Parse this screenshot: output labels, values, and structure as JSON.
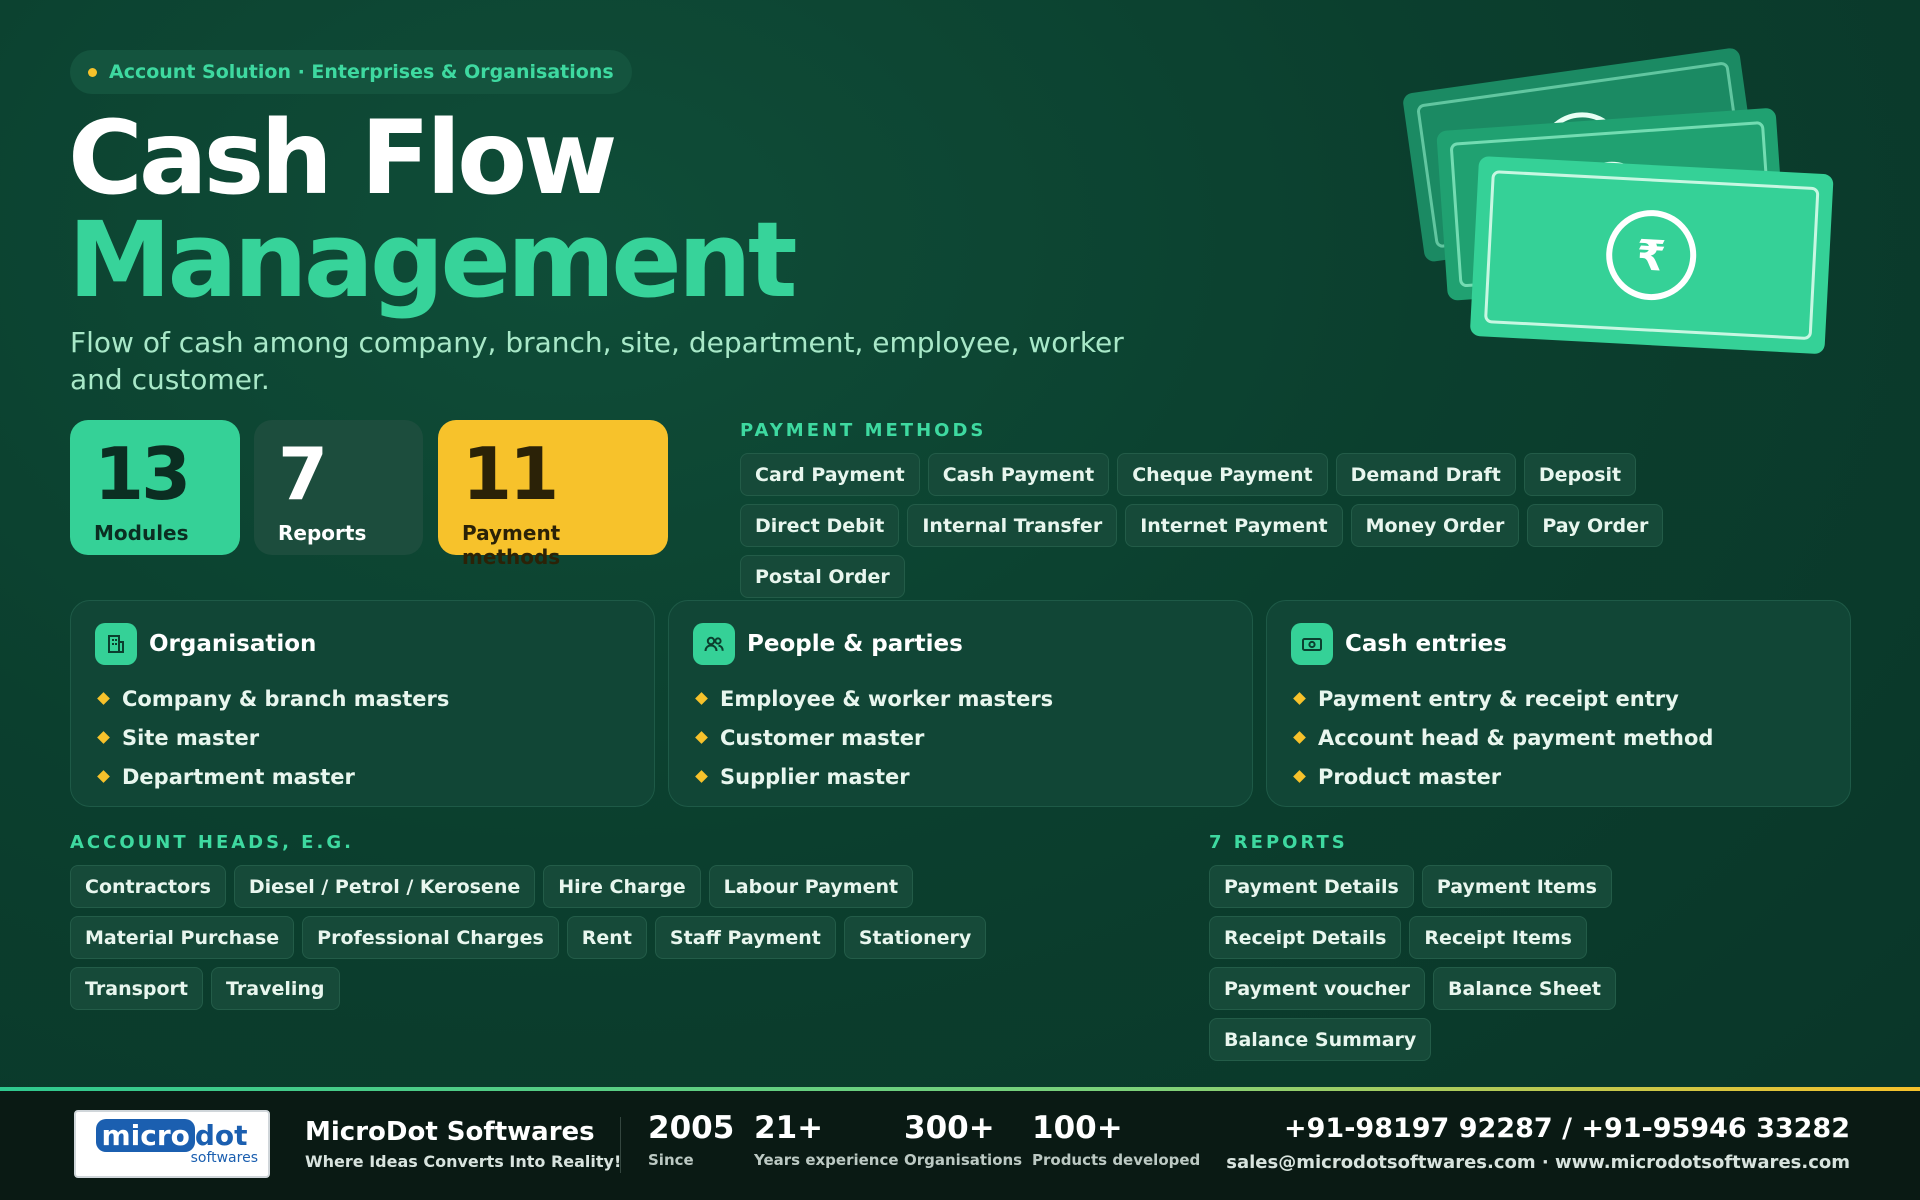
{
  "badge": "Account Solution · Enterprises & Organisations",
  "title": {
    "line1": "Cash Flow",
    "line2": "Management"
  },
  "subtitle": "Flow of cash among company, branch, site, department, employee, worker and customer.",
  "stats": [
    {
      "value": "13",
      "label": "Modules"
    },
    {
      "value": "7",
      "label": "Reports"
    },
    {
      "value": "11",
      "label": "Payment methods"
    }
  ],
  "payment_methods": {
    "label": "PAYMENT METHODS",
    "items": [
      "Card Payment",
      "Cash Payment",
      "Cheque Payment",
      "Demand Draft",
      "Deposit",
      "Direct Debit",
      "Internal Transfer",
      "Internet Payment",
      "Money Order",
      "Pay Order",
      "Postal Order"
    ]
  },
  "cards": [
    {
      "title": "Organisation",
      "icon": "building-icon",
      "items": [
        "Company & branch masters",
        "Site master",
        "Department master"
      ]
    },
    {
      "title": "People & parties",
      "icon": "people-icon",
      "items": [
        "Employee & worker masters",
        "Customer master",
        "Supplier master"
      ]
    },
    {
      "title": "Cash entries",
      "icon": "cash-icon",
      "items": [
        "Payment entry & receipt entry",
        "Account head & payment method",
        "Product master"
      ]
    }
  ],
  "account_heads": {
    "label": "ACCOUNT HEADS, E.G.",
    "items": [
      "Contractors",
      "Diesel / Petrol / Kerosene",
      "Hire Charge",
      "Labour Payment",
      "Material Purchase",
      "Professional Charges",
      "Rent",
      "Staff Payment",
      "Stationery",
      "Transport",
      "Traveling"
    ]
  },
  "reports": {
    "label": "7 REPORTS",
    "items": [
      "Payment Details",
      "Payment Items",
      "Receipt Details",
      "Receipt Items",
      "Payment voucher",
      "Balance Sheet",
      "Balance Summary"
    ]
  },
  "illustration": {
    "currency_symbol": "₹"
  },
  "footer": {
    "logo": {
      "part1": "micro",
      "part2": "dot",
      "part3": "softwares"
    },
    "company": "MicroDot Softwares",
    "tagline": "Where Ideas Converts Into Reality!",
    "stats": [
      {
        "value": "2005",
        "label": "Since"
      },
      {
        "value": "21+",
        "label": "Years experience"
      },
      {
        "value": "300+",
        "label": "Organisations"
      },
      {
        "value": "100+",
        "label": "Products developed"
      }
    ],
    "phone": "+91-98197 92287 / +91-95946 33282",
    "contact": "sales@microdotsoftwares.com · www.microdotsoftwares.com"
  },
  "colors": {
    "accent_green": "#35d197",
    "accent_yellow": "#f7c22b",
    "background": "#0b3f2e"
  }
}
